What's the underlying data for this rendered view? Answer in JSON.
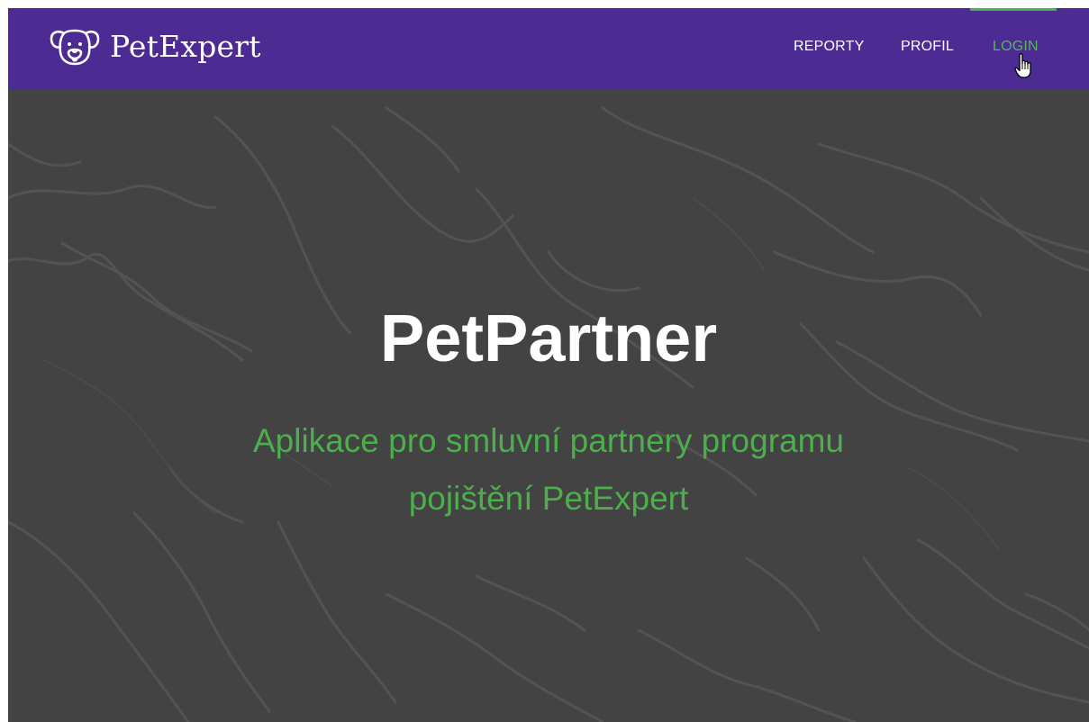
{
  "brand": {
    "name": "PetExpert",
    "icon": "dog-face-icon"
  },
  "nav": {
    "items": [
      {
        "label": "REPORTY"
      },
      {
        "label": "PROFIL"
      },
      {
        "label": "LOGIN"
      }
    ],
    "active": "LOGIN"
  },
  "hero": {
    "title": "PetPartner",
    "subtitle": "Aplikace pro smluvní partnery programu pojištění PetExpert"
  },
  "colors": {
    "navbar": "#4c2b93",
    "accent": "#4cae4c",
    "hero_bg": "#434343",
    "text": "#ffffff"
  }
}
